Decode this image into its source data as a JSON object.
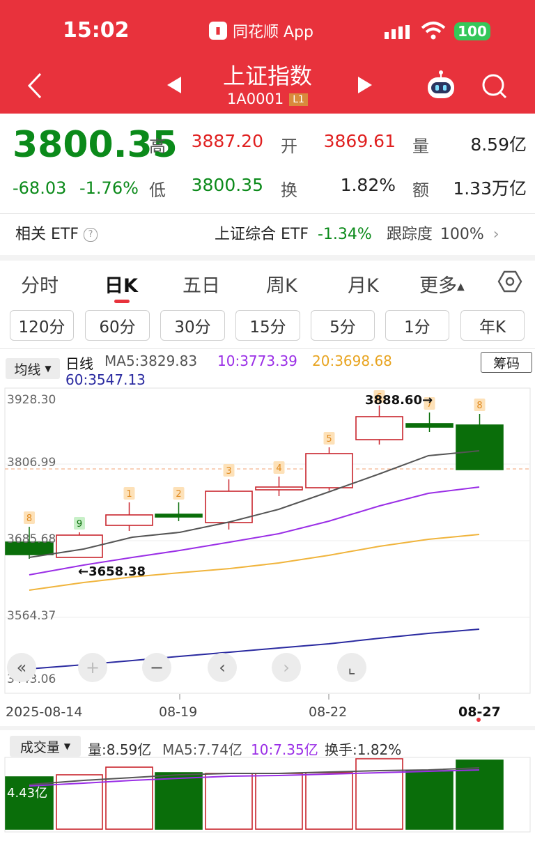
{
  "status": {
    "time": "15:02",
    "app": "同花顺 App",
    "battery": "100"
  },
  "header": {
    "title": "上证指数",
    "code": "1A0001",
    "level": "L1"
  },
  "quote": {
    "price": "3800.35",
    "change": "-68.03",
    "change_pct": "-1.76%",
    "high_label": "高",
    "high": "3887.20",
    "low_label": "低",
    "low": "3800.35",
    "open_label": "开",
    "open": "3869.61",
    "turnover_label": "换",
    "turnover": "1.82%",
    "volume_label": "量",
    "volume": "8.59亿",
    "amount_label": "额",
    "amount": "1.33万亿"
  },
  "etf": {
    "label": "相关 ETF",
    "name": "上证综合 ETF",
    "pct": "-1.34%",
    "track_label": "跟踪度",
    "track": "100%"
  },
  "tabs": [
    "分时",
    "日K",
    "五日",
    "周K",
    "月K",
    "更多"
  ],
  "intervals": [
    "120分",
    "60分",
    "30分",
    "15分",
    "5分",
    "1分",
    "年K"
  ],
  "legend": {
    "ma_select": "均线",
    "line_type": "日线",
    "ma5": "MA5:3829.83",
    "ma10": "10:3773.39",
    "ma20": "20:3698.68",
    "ma60": "60:3547.13",
    "chouma": "筹码"
  },
  "chart": {
    "y_ticks": [
      "3928.30",
      "3806.99",
      "3685.68",
      "3564.37",
      "3443.06"
    ],
    "dates": [
      "2025-08-14",
      "08-19",
      "08-22",
      "08-27"
    ],
    "high_marker": "3888.60→",
    "low_marker": "←3658.38",
    "counters": [
      "8",
      "9",
      "1",
      "2",
      "3",
      "4",
      "5",
      "6",
      "7",
      "8"
    ]
  },
  "volume": {
    "select": "成交量",
    "vol": "量:8.59亿",
    "ma5": "MA5:7.74亿",
    "ma10": "10:7.35亿",
    "turnover": "换手:1.82%",
    "y_label": "4.43亿"
  },
  "colors": {
    "up": "#c8242c",
    "down": "#0a6e0a",
    "ma5": "#555555",
    "ma10": "#9a2ee6",
    "ma20": "#f0b43c",
    "ma60": "#2a2aa0",
    "brand": "#e8323c"
  }
}
